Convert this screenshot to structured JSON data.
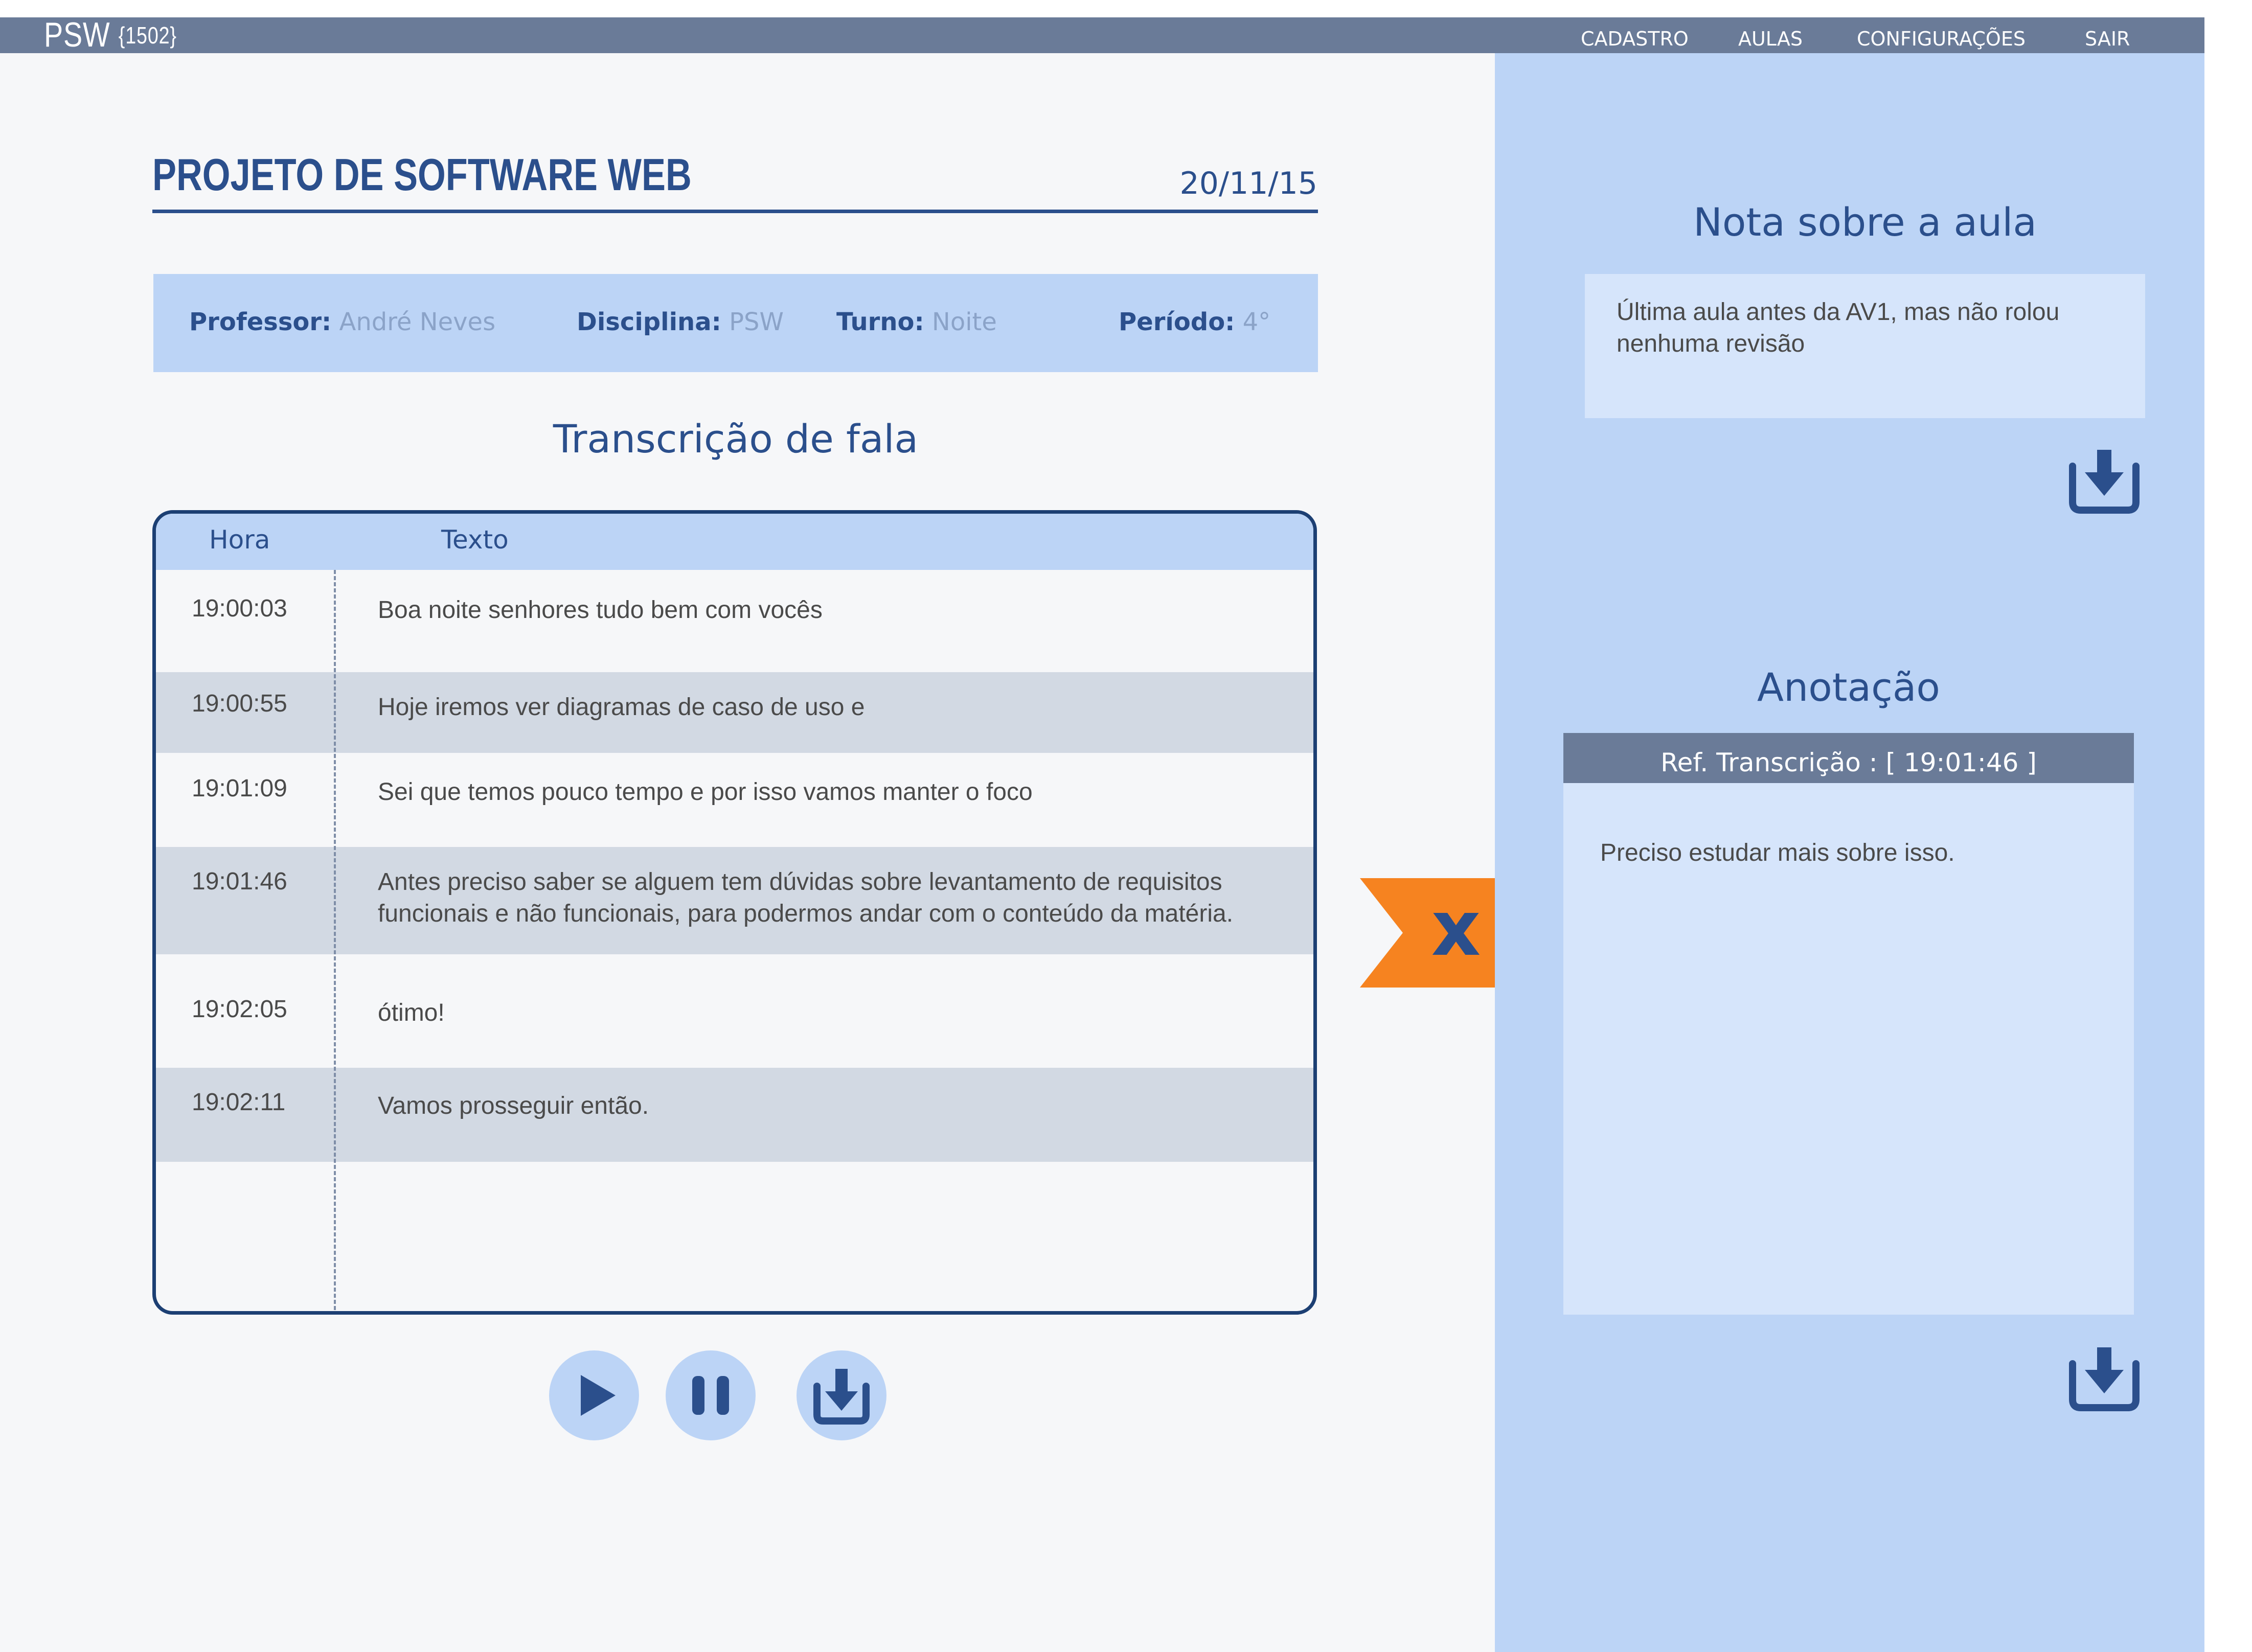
{
  "app": {
    "logo_text": "PSW",
    "logo_badge": "{1502}"
  },
  "nav": {
    "items": [
      "CADASTRO",
      "AULAS",
      "CONFIGURAÇÕES",
      "SAIR"
    ]
  },
  "header": {
    "title": "PROJETO DE SOFTWARE WEB",
    "date": "20/11/15"
  },
  "info": {
    "professor_label": "Professor:",
    "professor_value": "André Neves",
    "disciplina_label": "Disciplina:",
    "disciplina_value": "PSW",
    "turno_label": "Turno:",
    "turno_value": "Noite",
    "periodo_label": "Período:",
    "periodo_value": "4°"
  },
  "transcription": {
    "title": "Transcrição de fala",
    "columns": [
      "Hora",
      "Texto"
    ],
    "rows": [
      {
        "time": "19:00:03",
        "text": "Boa noite senhores tudo bem com vocês"
      },
      {
        "time": "19:00:55",
        "text": "Hoje iremos ver diagramas de caso de uso e"
      },
      {
        "time": "19:01:09",
        "text": "Sei que temos pouco tempo e por isso vamos manter o foco"
      },
      {
        "time": "19:01:46",
        "text": "Antes preciso saber se alguem tem dúvidas sobre levantamento de requisitos funcionais e não funcionais, para podermos andar com o conteúdo da matéria."
      },
      {
        "time": "19:02:05",
        "text": "ótimo!"
      },
      {
        "time": "19:02:11",
        "text": "Vamos prosseguir então."
      }
    ]
  },
  "controls": {
    "icons": [
      "play-icon",
      "pause-icon",
      "download-icon"
    ]
  },
  "note": {
    "title": "Nota sobre a aula",
    "text": "Última aula antes da AV1, mas não rolou nenhuma revisão"
  },
  "annotation": {
    "title": "Anotação",
    "ref_label": "Ref. Transcrição :  [ 19:01:46 ]",
    "text": "Preciso estudar mais sobre isso."
  },
  "colors": {
    "nav_bg": "#6a7b98",
    "accent": "#2b4f8c",
    "panel": "#bcd4f6",
    "arrow": "#f68320"
  }
}
